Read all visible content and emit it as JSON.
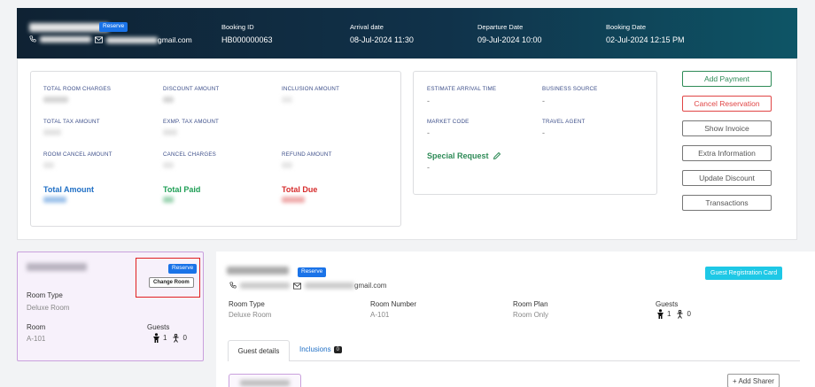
{
  "header": {
    "badge": "Reserve",
    "email_suffix": "gmail.com",
    "booking_id_label": "Booking ID",
    "booking_id": "HB000000063",
    "arrival_label": "Arrival date",
    "arrival": "08-Jul-2024 11:30",
    "departure_label": "Departure Date",
    "departure": "09-Jul-2024 10:00",
    "booking_date_label": "Booking Date",
    "booking_date": "02-Jul-2024 12:15 PM"
  },
  "charges": {
    "total_room_charges": "TOTAL ROOM CHARGES",
    "discount_amount": "DISCOUNT AMOUNT",
    "inclusion_amount": "INCLUSION AMOUNT",
    "total_tax_amount": "TOTAL TAX AMOUNT",
    "exmp_tax_amount": "EXMP. TAX AMOUNT",
    "room_cancel_amount": "ROOM CANCEL AMOUNT",
    "cancel_charges": "CANCEL CHARGES",
    "refund_amount": "REFUND AMOUNT",
    "total_amount": "Total Amount",
    "total_paid": "Total Paid",
    "total_due": "Total Due"
  },
  "info": {
    "eta_label": "ESTIMATE ARRIVAL TIME",
    "eta": "-",
    "business_source_label": "BUSINESS SOURCE",
    "business_source": "-",
    "market_code_label": "MARKET CODE",
    "market_code": "-",
    "travel_agent_label": "TRAVEL AGENT",
    "travel_agent": "-",
    "special_request_label": "Special Request",
    "special_request": "-"
  },
  "actions": {
    "add_payment": "Add Payment",
    "cancel_reservation": "Cancel Reservation",
    "show_invoice": "Show Invoice",
    "extra_information": "Extra Information",
    "update_discount": "Update Discount",
    "transactions": "Transactions"
  },
  "room_card": {
    "badge": "Reserve",
    "change_room": "Change Room",
    "room_type_label": "Room Type",
    "room_type": "Deluxe Room",
    "room_label": "Room",
    "room": "A-101",
    "guests_label": "Guests",
    "adults": "1",
    "children": "0"
  },
  "detail": {
    "badge": "Reserve",
    "email_suffix": "gmail.com",
    "guest_reg_card": "Guest Registration Card",
    "room_type_label": "Room Type",
    "room_type": "Deluxe Room",
    "room_number_label": "Room Number",
    "room_number": "A-101",
    "room_plan_label": "Room Plan",
    "room_plan": "Room Only",
    "guests_label": "Guests",
    "adults": "1",
    "children": "0",
    "tab_guest_details": "Guest details",
    "tab_inclusions": "Inclusions",
    "inclusions_count": "0",
    "add_sharer": "+ Add Sharer"
  },
  "colors": {
    "header_start": "#0f2233",
    "header_end": "#0e5566",
    "green": "#2e8b57",
    "red": "#e04545",
    "blue": "#1a73e8",
    "highlight": "#e02020"
  }
}
